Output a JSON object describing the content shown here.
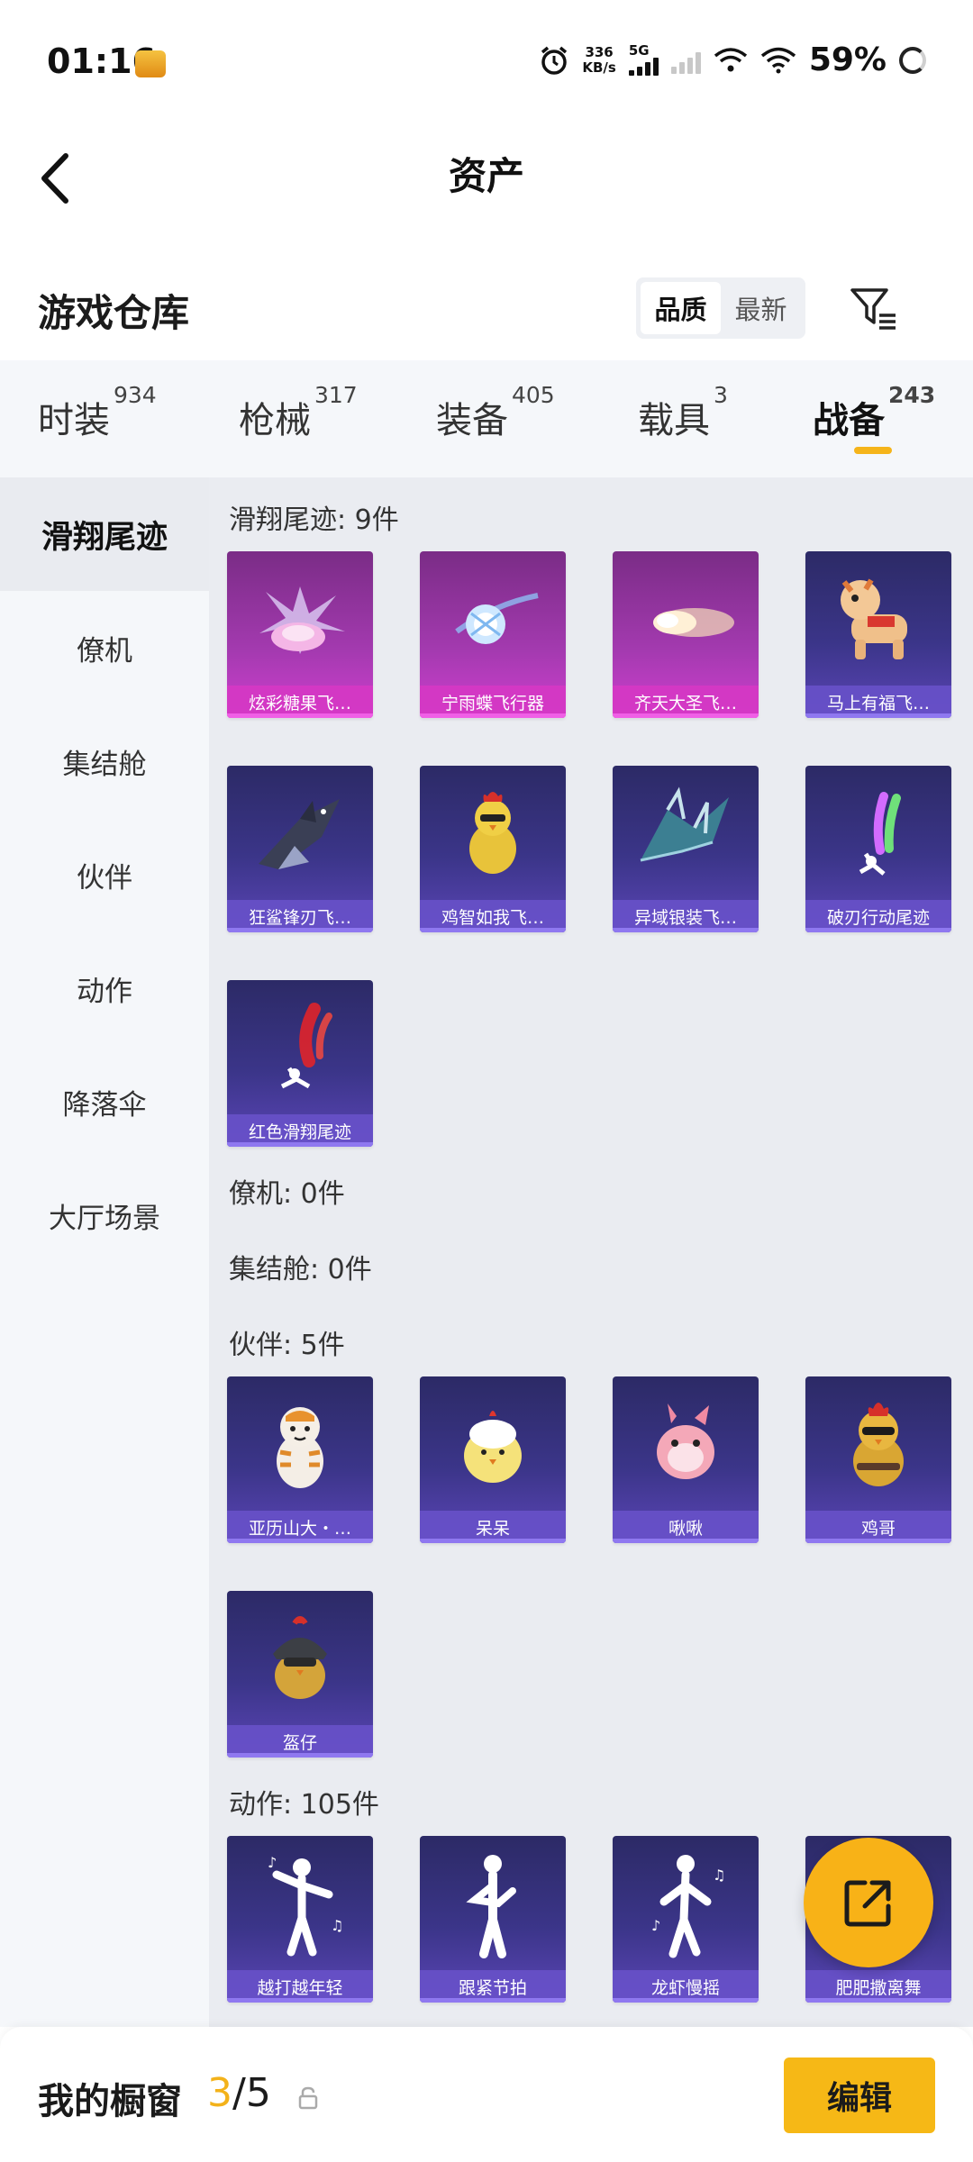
{
  "status_bar": {
    "time": "01:16",
    "net_speed_value": "336",
    "net_speed_unit": "KB/s",
    "network_type": "5G",
    "battery": "59%"
  },
  "header": {
    "title": "资产",
    "back_icon": "chevron-left-icon"
  },
  "warehouse": {
    "title": "游戏仓库",
    "sort_options": [
      "品质",
      "最新"
    ],
    "sort_selected": "品质",
    "filter_icon": "filter-icon"
  },
  "tabs": [
    {
      "label": "时装",
      "count": "934"
    },
    {
      "label": "枪械",
      "count": "317"
    },
    {
      "label": "装备",
      "count": "405"
    },
    {
      "label": "载具",
      "count": "3"
    },
    {
      "label": "战备",
      "count": "243",
      "active": true
    }
  ],
  "sidebar": {
    "items": [
      "滑翔尾迹",
      "僚机",
      "集结舱",
      "伙伴",
      "动作",
      "降落伞",
      "大厅场景"
    ],
    "active": "滑翔尾迹"
  },
  "sections": [
    {
      "title": "滑翔尾迹: 9件",
      "items": [
        {
          "name": "炫彩糖果飞…",
          "quality": "pink",
          "icon": "candy-glider-icon"
        },
        {
          "name": "宁雨蝶飞行器",
          "quality": "pink",
          "icon": "ice-orb-glider-icon"
        },
        {
          "name": "齐天大圣飞…",
          "quality": "pink",
          "icon": "cloud-glider-icon"
        },
        {
          "name": "马上有福飞…",
          "quality": "purple",
          "icon": "toy-horse-icon"
        },
        {
          "name": "狂鲨锋刃飞…",
          "quality": "purple",
          "icon": "shark-glider-icon"
        },
        {
          "name": "鸡智如我飞…",
          "quality": "purple",
          "icon": "chicken-glider-icon"
        },
        {
          "name": "异域银装飞…",
          "quality": "purple",
          "icon": "winged-glider-icon"
        },
        {
          "name": "破刃行动尾迹",
          "quality": "purple",
          "icon": "smoke-trail-icon"
        },
        {
          "name": "红色滑翔尾迹",
          "quality": "purple",
          "icon": "red-smoke-trail-icon"
        }
      ]
    },
    {
      "title": "僚机: 0件",
      "items": []
    },
    {
      "title": "集结舱: 0件",
      "items": []
    },
    {
      "title": "伙伴: 5件",
      "items": [
        {
          "name": "亚历山大・…",
          "quality": "purple",
          "icon": "tiger-chick-icon"
        },
        {
          "name": "呆呆",
          "quality": "purple",
          "icon": "yellow-chick-icon"
        },
        {
          "name": "啾啾",
          "quality": "purple",
          "icon": "pink-bird-icon"
        },
        {
          "name": "鸡哥",
          "quality": "purple",
          "icon": "sunglasses-chicken-icon"
        },
        {
          "name": "盔仔",
          "quality": "purple",
          "icon": "helmet-chick-icon"
        }
      ]
    },
    {
      "title": "动作: 105件",
      "items": [
        {
          "name": "越打越年轻",
          "quality": "purple",
          "icon": "dance-pose-icon"
        },
        {
          "name": "跟紧节拍",
          "quality": "purple",
          "icon": "dance-pose-icon"
        },
        {
          "name": "龙虾慢摇",
          "quality": "purple",
          "icon": "dance-pose-icon"
        },
        {
          "name": "肥肥撒离舞",
          "quality": "purple",
          "icon": "dance-pose-icon"
        }
      ]
    }
  ],
  "fab_icon": "share-out-icon",
  "bottom_bar": {
    "showcase_label": "我的橱窗",
    "showcase_current": "3",
    "showcase_total": "/5",
    "lock_icon": "lock-icon",
    "edit_label": "编辑"
  }
}
